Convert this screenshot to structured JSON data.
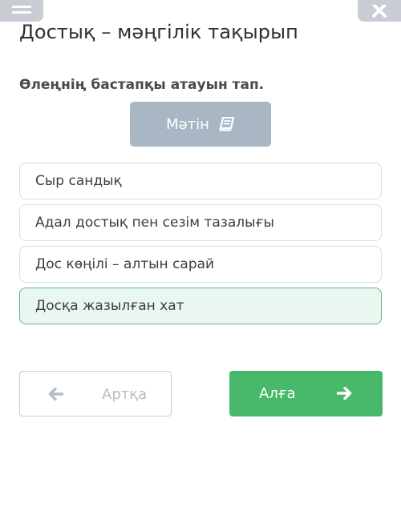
{
  "header": {
    "menu_icon": "hamburger-menu-icon",
    "close_icon": "close-x-icon",
    "title": "Достық – мәңгілік тақырып"
  },
  "question": {
    "text": "Өлеңнің бастапқы атауын тап."
  },
  "text_button": {
    "label": "Мәтін",
    "icon": "book-icon"
  },
  "options": [
    {
      "label": "Сыр сандық",
      "selected": false
    },
    {
      "label": "Адал достық пен сезім тазалығы",
      "selected": false
    },
    {
      "label": "Дос көңілі – алтын сарай",
      "selected": false
    },
    {
      "label": "Досқа жазылған хат",
      "selected": true
    }
  ],
  "navigation": {
    "back_label": "Артқа",
    "next_label": "Алға",
    "back_icon": "arrow-left-icon",
    "next_icon": "arrow-right-icon"
  },
  "colors": {
    "accent_green": "#48b96a",
    "selected_border": "#5ab888",
    "selected_bg": "#eaf7f0",
    "text_button_bg": "#a9b7c4"
  }
}
